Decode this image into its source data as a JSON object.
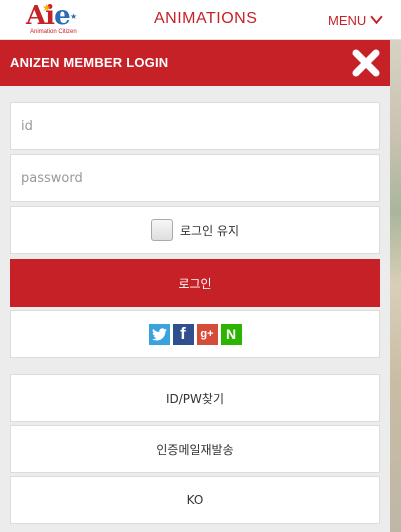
{
  "topbar": {
    "logo_text": "Aie",
    "logo_tagline": "Animation Citizen",
    "title": "ANIMATIONS",
    "menu_label": "MENU"
  },
  "panel": {
    "title": "ANIZEN MEMBER LOGIN",
    "id_placeholder": "id",
    "password_placeholder": "password",
    "remember_label": "로그인 유지",
    "login_button": "로그인",
    "social_icons": [
      "twitter-icon",
      "facebook-icon",
      "google-plus-icon",
      "naver-icon"
    ],
    "find_idpw": "ID/PW찾기",
    "resend_email": "인증메일재발송",
    "language": "KO"
  },
  "colors": {
    "brand_red": "#c62127",
    "twitter": "#3aa3dd",
    "facebook": "#2f4f8f",
    "google": "#d54c3a",
    "naver": "#2db400"
  }
}
